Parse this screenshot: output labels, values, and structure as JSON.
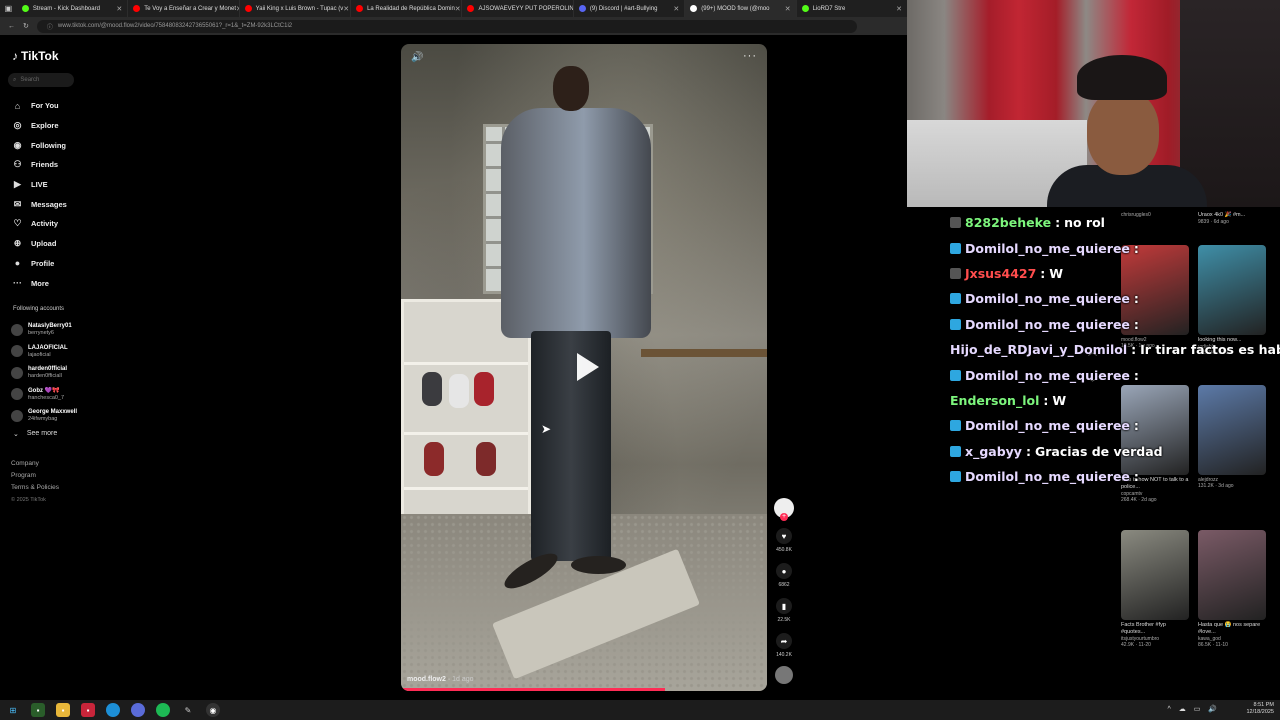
{
  "browser": {
    "tabs": [
      {
        "title": "Stream - Kick Dashboard",
        "color": "#53fc18"
      },
      {
        "title": "Te Voy a Enseñar a Crear y Monet",
        "color": "#ff0000"
      },
      {
        "title": "Yaii King x Luis Brown - Tupac (v",
        "color": "#ff0000"
      },
      {
        "title": "La Realidad de República Domin",
        "color": "#ff0000"
      },
      {
        "title": "AJSOWAEVEYY PUT POPEROLIN",
        "color": "#ff0000"
      },
      {
        "title": "(9) Discord | #art-Bullying",
        "color": "#5865f2"
      },
      {
        "title": "(99+) MOOD flow (@moo",
        "color": "#ffffff"
      },
      {
        "title": "LioRD7 Stre",
        "color": "#53fc18"
      }
    ],
    "url": "www.tiktok.com/@mood.flow2/video/7584808324273655061?_r=1&_t=ZM-92k3LCtC1i2"
  },
  "tiktok": {
    "logo": "TikTok",
    "search_placeholder": "Search",
    "nav": [
      {
        "label": "For You",
        "icon": "home-icon",
        "glyph": "⌂"
      },
      {
        "label": "Explore",
        "icon": "compass-icon",
        "glyph": "◎"
      },
      {
        "label": "Following",
        "icon": "following-icon",
        "glyph": "◉"
      },
      {
        "label": "Friends",
        "icon": "friends-icon",
        "glyph": "⚇"
      },
      {
        "label": "LIVE",
        "icon": "live-icon",
        "glyph": "▶"
      },
      {
        "label": "Messages",
        "icon": "messages-icon",
        "glyph": "✉"
      },
      {
        "label": "Activity",
        "icon": "activity-icon",
        "glyph": "♡"
      },
      {
        "label": "Upload",
        "icon": "upload-icon",
        "glyph": "⊕"
      },
      {
        "label": "Profile",
        "icon": "profile-icon",
        "glyph": "●"
      },
      {
        "label": "More",
        "icon": "more-icon",
        "glyph": "···"
      }
    ],
    "following_title": "Following accounts",
    "following": [
      {
        "name": "NataslyBerry01",
        "handle": "berrynety6"
      },
      {
        "name": "LAJAOFICIAL",
        "handle": "lajaoficial"
      },
      {
        "name": "harden0fficial",
        "handle": "harden0fficiall"
      },
      {
        "name": "Gobz 💜🎀",
        "handle": "franchesca0_7"
      },
      {
        "name": "George Maxxwell",
        "handle": "24ifwmybag"
      }
    ],
    "see_more": "See more",
    "footer": [
      "Company",
      "Program",
      "Terms & Policies"
    ],
    "copyright": "© 2025 TikTok",
    "video": {
      "author": "mood.flow2",
      "age": "1d ago",
      "progress": 0.72,
      "likes": "450.8K",
      "comments": "6862",
      "saves": "22.5K",
      "shares": "140.2K"
    }
  },
  "chat": [
    {
      "user": "8282beheke",
      "text": "no rol",
      "color": "#7cf57c",
      "badge": "#555555"
    },
    {
      "user": "Domilol_no_me_quieree",
      "text": "",
      "color": "#e6d9ff",
      "badge": "#2ea7e0"
    },
    {
      "user": "Jxsus4427",
      "text": "W",
      "color": "#ff4d4d",
      "badge": "#555555"
    },
    {
      "user": "Domilol_no_me_quieree",
      "text": "",
      "color": "#e6d9ff",
      "badge": "#2ea7e0"
    },
    {
      "user": "Domilol_no_me_quieree",
      "text": "",
      "color": "#e6d9ff",
      "badge": "#2ea7e0"
    },
    {
      "user": "Hijo_de_RDJavi_y_Domilol",
      "text": "Ir tirar factos es hablar",
      "color": "#e6d9ff",
      "badge": ""
    },
    {
      "user": "Domilol_no_me_quieree",
      "text": "",
      "color": "#e6d9ff",
      "badge": "#2ea7e0"
    },
    {
      "user": "Enderson_lol",
      "text": "W",
      "color": "#7cf57c",
      "badge": ""
    },
    {
      "user": "Domilol_no_me_quieree",
      "text": "",
      "color": "#e6d9ff",
      "badge": "#2ea7e0"
    },
    {
      "user": "x_gabyy",
      "text": "Gracias de verdad",
      "color": "#e6d9ff",
      "badge": "#2ea7e0"
    },
    {
      "user": "Domilol_no_me_quieree",
      "text": "",
      "color": "#e6d9ff",
      "badge": "#2ea7e0"
    }
  ],
  "side_videos": [
    {
      "caption": "",
      "author": "chrisruggles0",
      "stats": "",
      "color": "#b8c0c8"
    },
    {
      "caption": "Uraox 4k0 🎉 #m...",
      "author": "",
      "stats": "9839 · 6d ago",
      "color": "#6f8f6a"
    },
    {
      "caption": "",
      "author": "mood.flow2",
      "stats": "12.5K · 1w ago",
      "color": "#c23a3a"
    },
    {
      "caption": "looking this now...",
      "author": "yrdiablo",
      "stats": "295.7K · 10-8",
      "color": "#3f8fa8"
    },
    {
      "caption": "This is how NOT to talk to a police...",
      "author": "copcamtv",
      "stats": "268.4K · 2d ago",
      "color": "#9aa6b8"
    },
    {
      "caption": "",
      "author": "alejdrozz",
      "stats": "131.2K · 3d ago",
      "color": "#5c7aa8"
    },
    {
      "caption": "Facts Brother #fyp #quotes...",
      "author": "itsjustyourtumbro",
      "stats": "42.9K · 11-20",
      "color": "#8a8a80"
    },
    {
      "caption": "Hasta que 😭 nos separe #love...",
      "author": "kawa_god",
      "stats": "86.5K · 11-10",
      "color": "#7a5a66"
    }
  ],
  "taskbar": {
    "time": "8:51 PM",
    "date": "12/18/2025"
  }
}
